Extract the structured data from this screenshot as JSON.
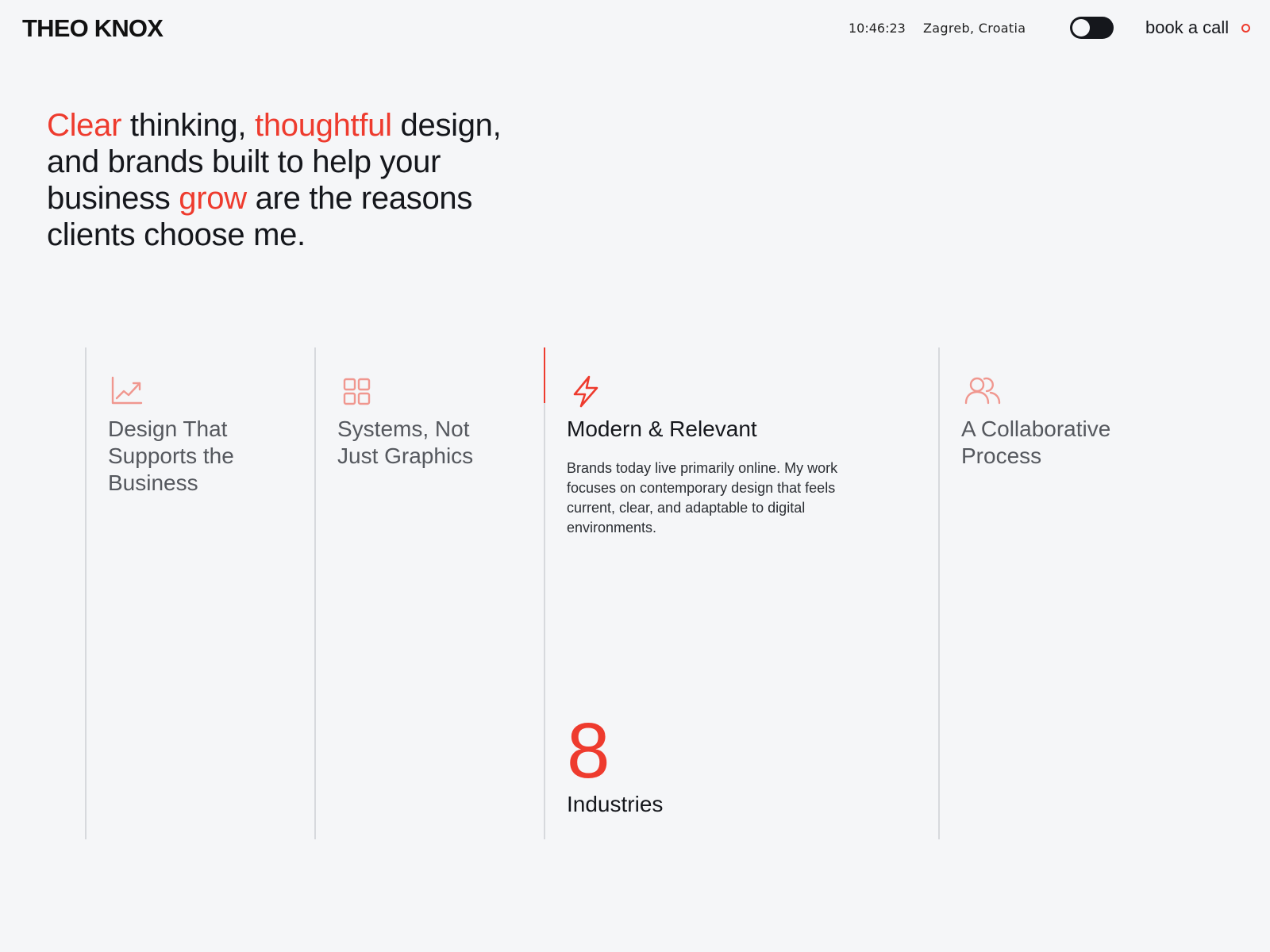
{
  "header": {
    "logo": "THEO KNOX",
    "time": "10:46:23",
    "location": "Zagreb, Croatia",
    "cta_label": "book a call",
    "theme_toggle": "dark-mode-toggle"
  },
  "hero": {
    "parts": [
      {
        "text": "Clear",
        "accent": true
      },
      {
        "text": " thinking, ",
        "accent": false
      },
      {
        "text": "thoughtful",
        "accent": true
      },
      {
        "text": " design, and brands built to help your business ",
        "accent": false
      },
      {
        "text": "grow",
        "accent": true
      },
      {
        "text": " are the reasons clients choose me.",
        "accent": false
      }
    ]
  },
  "colors": {
    "accent": "#ee3b2e",
    "text": "#15171c",
    "background": "#f5f6f8",
    "divider": "#d7d9dd"
  },
  "columns": [
    {
      "icon": "trending-up-icon",
      "title": "Design That Supports the Business"
    },
    {
      "icon": "grid-icon",
      "title": "Systems, Not Just Graphics"
    },
    {
      "icon": "lightning-icon",
      "title": "Modern & Relevant",
      "description": "Brands today live primarily online. My work focuses on contemporary design that feels current, clear, and adaptable to digital environments.",
      "stat_value": "8",
      "stat_label": "Industries"
    },
    {
      "icon": "users-icon",
      "title": "A Collaborative Process"
    }
  ]
}
